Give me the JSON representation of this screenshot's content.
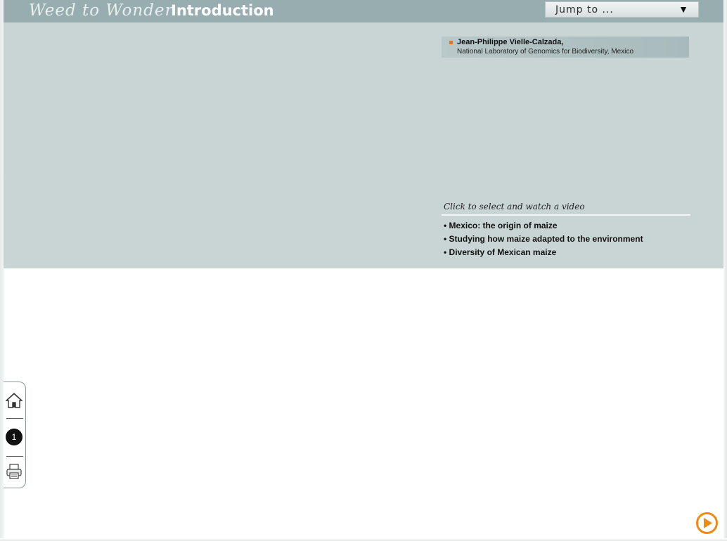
{
  "header": {
    "brand": "Weed to Wonder",
    "section_title": "Introduction",
    "jump_label": "Jump to ...",
    "jump_arrow_icon": "triangle-down-icon"
  },
  "speaker": {
    "name": "Jean-Philippe Vielle-Calzada,",
    "affiliation": "National Laboratory of Genomics for Biodiversity, Mexico"
  },
  "videos": {
    "heading": "Click to select and watch a video",
    "items": [
      "• Mexico: the origin of maize",
      "• Studying how maize adapted to the environment",
      "• Diversity of Mexican maize"
    ]
  },
  "side_nav": {
    "home_icon": "home-icon",
    "page_number": "1",
    "print_icon": "printer-icon"
  },
  "next": {
    "icon": "play-next-icon"
  },
  "colors": {
    "header_bg": "#97adb0",
    "panel_bg": "#c9d5d5",
    "accent_orange": "#e8741f"
  }
}
